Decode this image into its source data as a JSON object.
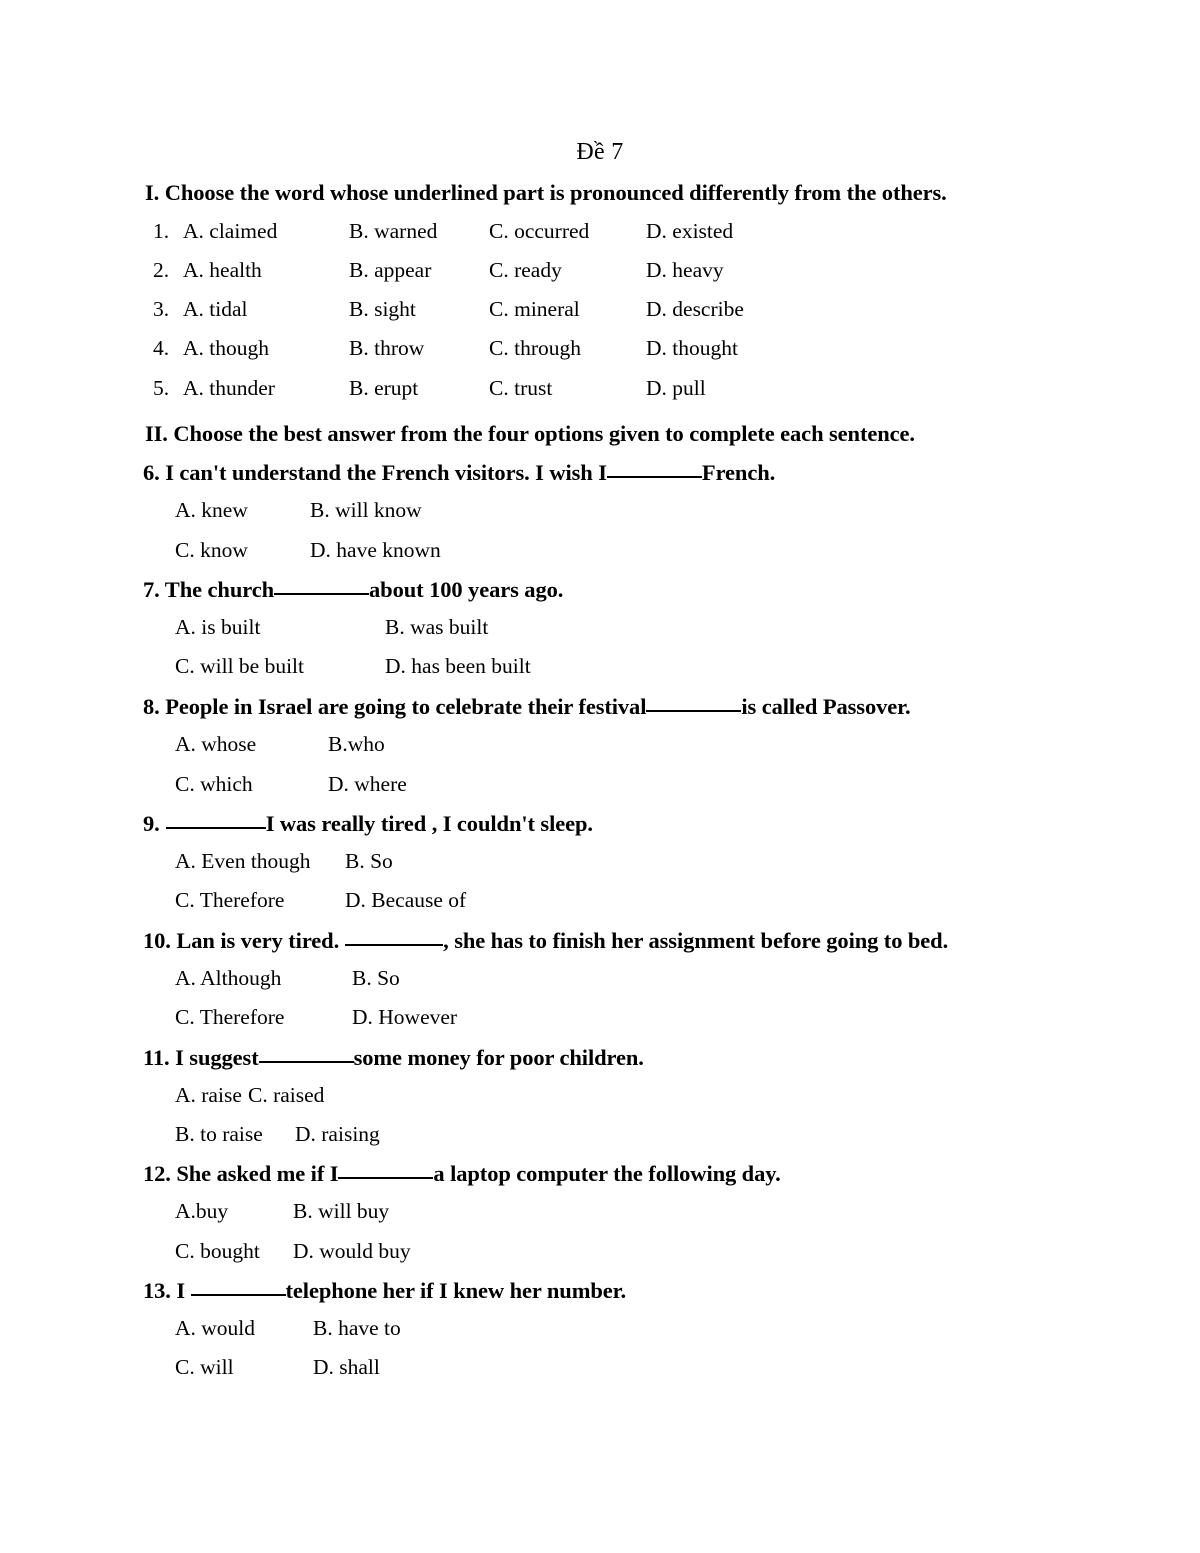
{
  "document": {
    "title": "Đề 7"
  },
  "sections": [
    {
      "heading": "I. Choose the word whose underlined part is pronounced differently from the others.",
      "questions": [
        {
          "number": "1.",
          "a": "A. claimed",
          "b": "B. warned",
          "c": "C. occurred",
          "d": "D. existed"
        },
        {
          "number": "2.",
          "a": "A. health",
          "b": "B. appear",
          "c": "C. ready",
          "d": "D. heavy"
        },
        {
          "number": "3.",
          "a": "A. tidal",
          "b": "B. sight",
          "c": "C. mineral",
          "d": "D. describe"
        },
        {
          "number": "4.",
          "a": "A. though",
          "b": "B. throw",
          "c": "C. through",
          "d": "D. thought"
        },
        {
          "number": "5.",
          "a": "A. thunder",
          "b": "B. erupt",
          "c": "C. trust",
          "d": "D. pull"
        }
      ]
    },
    {
      "heading": "II. Choose the best answer from the four options given to complete each sentence.",
      "questions": [
        {
          "number": "6.",
          "stem_before": "6. I can't understand the French visitors. I wish I",
          "stem_after": "French.",
          "row1_left": "A. knew",
          "row1_right": "B. will know",
          "row2_left": "C. know",
          "row2_right": "D. have known"
        },
        {
          "number": "7.",
          "stem_before": "7. The church",
          "stem_after": "about 100 years ago.",
          "row1_left": "A. is built",
          "row1_right": "B. was built",
          "row2_left": "C. will be built",
          "row2_right": "D. has been built"
        },
        {
          "number": "8.",
          "stem_before": "8. People in Israel are going to celebrate their festival",
          "stem_after": "is called Passover.",
          "row1_left": "A. whose",
          "row1_right": "B.who",
          "row2_left": "C. which",
          "row2_right": "D. where"
        },
        {
          "number": "9.",
          "stem_before": "9.",
          "stem_after": "I was really tired , I couldn't sleep.",
          "row1_left": "A. Even though",
          "row1_right": "B. So",
          "row2_left": "C. Therefore",
          "row2_right": "D. Because of"
        },
        {
          "number": "10.",
          "stem_before": "10. Lan is very tired.",
          "stem_after": ", she has to finish her assignment before going to bed.",
          "row1_left": "A. Although",
          "row1_right": "B. So",
          "row2_left": "C. Therefore",
          "row2_right": "D. However"
        },
        {
          "number": "11.",
          "stem_before": "11. I suggest",
          "stem_after": "some money for poor children.",
          "row1_left": "A. raise",
          "row1_right": "C. raised",
          "row2_left": "B. to raise",
          "row2_right": "D. raising"
        },
        {
          "number": "12.",
          "stem_before": "12. She asked me if I",
          "stem_after": "a laptop computer the following day.",
          "row1_left": "A.buy",
          "row1_right": "B. will buy",
          "row2_left": "C. bought",
          "row2_right": "D. would buy"
        },
        {
          "number": "13.",
          "stem_before": "13. I ",
          "stem_after": "telephone her if I knew her number.",
          "row1_left": "A. would",
          "row1_right": "B. have to",
          "row2_left": "C. will",
          "row2_right": "D. shall"
        }
      ]
    }
  ]
}
